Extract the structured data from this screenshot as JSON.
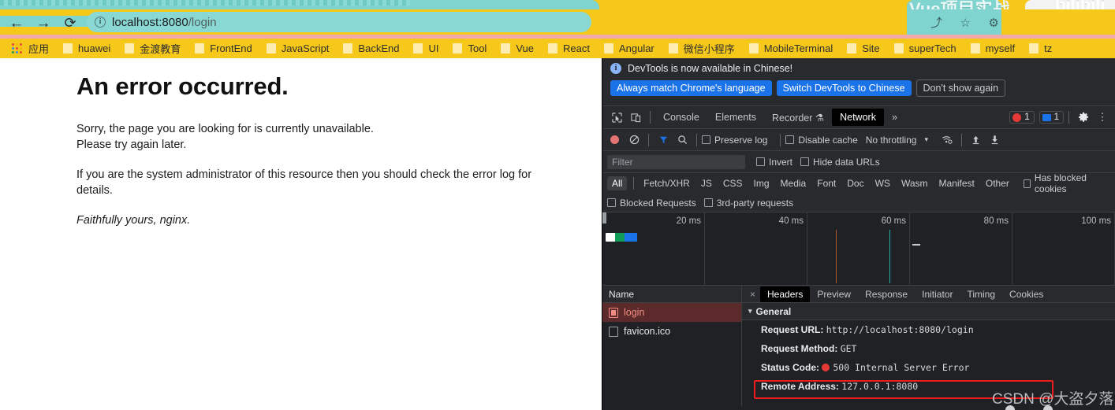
{
  "browser": {
    "tabs": [
      {
        "title": "Vue项目实战",
        "icons": [
          "share-icon",
          "star-icon"
        ]
      },
      {
        "title": "bilibili",
        "icons": []
      }
    ],
    "nav": {
      "back": "←",
      "forward": "→",
      "reload": "⟳"
    },
    "omnibox": {
      "icon": "info-icon",
      "url_host": "localhost:8080",
      "url_path": "/login",
      "url_full": "localhost:8080/login"
    },
    "omni_actions": [
      "★",
      "⬚",
      "⚙"
    ],
    "bookmarks": [
      {
        "label": "应用",
        "icon": "apps-grid-icon"
      },
      {
        "label": "huawei",
        "icon": "folder-icon"
      },
      {
        "label": "金渡教育",
        "icon": "folder-icon"
      },
      {
        "label": "FrontEnd",
        "icon": "folder-icon"
      },
      {
        "label": "JavaScript",
        "icon": "folder-icon"
      },
      {
        "label": "BackEnd",
        "icon": "folder-icon"
      },
      {
        "label": "UI",
        "icon": "folder-icon"
      },
      {
        "label": "Tool",
        "icon": "folder-icon"
      },
      {
        "label": "Vue",
        "icon": "folder-icon"
      },
      {
        "label": "React",
        "icon": "folder-icon"
      },
      {
        "label": "Angular",
        "icon": "folder-icon"
      },
      {
        "label": "微信小程序",
        "icon": "folder-icon"
      },
      {
        "label": "MobileTerminal",
        "icon": "folder-icon"
      },
      {
        "label": "Site",
        "icon": "folder-icon"
      },
      {
        "label": "superTech",
        "icon": "folder-icon"
      },
      {
        "label": "myself",
        "icon": "folder-icon"
      },
      {
        "label": "tz",
        "icon": "folder-icon"
      }
    ]
  },
  "error_page": {
    "heading": "An error occurred.",
    "para1_line1": "Sorry, the page you are looking for is currently unavailable.",
    "para1_line2": "Please try again later.",
    "para2": "If you are the system administrator of this resource then you should check the error log for details.",
    "signature": "Faithfully yours, nginx."
  },
  "devtools": {
    "banner": {
      "message": "DevTools is now available in Chinese!",
      "btn_always": "Always match Chrome's language",
      "btn_switch": "Switch DevTools to Chinese",
      "btn_dismiss": "Don't show again"
    },
    "panel_tabs": [
      {
        "label": "Console",
        "active": false
      },
      {
        "label": "Elements",
        "active": false
      },
      {
        "label": "Recorder",
        "active": false,
        "suffix": "⚗"
      },
      {
        "label": "Network",
        "active": true
      }
    ],
    "more_tabs": "»",
    "badges": {
      "errors": "1",
      "messages": "1",
      "error_color": "#e53935",
      "message_color": "#1a73e8"
    },
    "toolbar": {
      "record_label": "record-button",
      "clear_label": "clear-button",
      "filter_label": "filter-button",
      "search_label": "search-button",
      "preserve_log": "Preserve log",
      "disable_cache": "Disable cache",
      "throttling": "No throttling",
      "throttling_caret": "▾",
      "import_label": "import-har-button",
      "export_label": "export-har-button"
    },
    "filterbar": {
      "placeholder": "Filter",
      "value": "",
      "invert": "Invert",
      "hide_data_urls": "Hide data URLs"
    },
    "types": [
      "All",
      "Fetch/XHR",
      "JS",
      "CSS",
      "Img",
      "Media",
      "Font",
      "Doc",
      "WS",
      "Wasm",
      "Manifest",
      "Other"
    ],
    "active_type": "All",
    "type_extras": [
      "Has blocked cookies",
      "Blocked Requests",
      "3rd-party requests"
    ],
    "timeline": {
      "ticks": [
        "20 ms",
        "40 ms",
        "60 ms",
        "80 ms",
        "100 ms"
      ],
      "bar_segments": [
        "#ffffff",
        "#0f9d58",
        "#1a73e8"
      ],
      "event_lines": [
        {
          "color": "#b05a2a",
          "left_pct": 45.5
        },
        {
          "color": "#25b7a5",
          "left_pct": 56.0
        }
      ]
    },
    "requests": {
      "column_header": "Name",
      "rows": [
        {
          "name": "login",
          "selected": true
        },
        {
          "name": "favicon.ico",
          "selected": false
        }
      ]
    },
    "detail_tabs": [
      {
        "label": "Headers",
        "active": true
      },
      {
        "label": "Preview",
        "active": false
      },
      {
        "label": "Response",
        "active": false
      },
      {
        "label": "Initiator",
        "active": false
      },
      {
        "label": "Timing",
        "active": false
      },
      {
        "label": "Cookies",
        "active": false
      }
    ],
    "detail_close": "×",
    "general_section": {
      "title": "General",
      "caret": "▾",
      "rows": [
        {
          "key": "Request URL:",
          "value": "http://localhost:8080/login"
        },
        {
          "key": "Request Method:",
          "value": "GET"
        },
        {
          "key": "Status Code:",
          "value": "500 Internal Server Error",
          "status_dot": true
        },
        {
          "key": "Remote Address:",
          "value": "127.0.0.1:8080"
        }
      ]
    },
    "highlight_color": "#ee1c1c"
  },
  "watermark": {
    "text": "CSDN @大盗夕落"
  }
}
